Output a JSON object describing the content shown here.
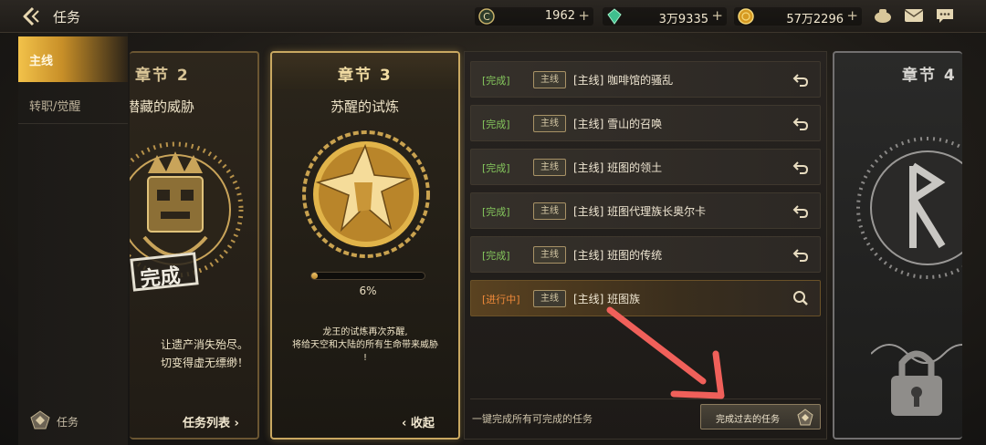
{
  "header": {
    "title": "任务",
    "resources": [
      {
        "icon": "coin-c-icon",
        "value": "1962"
      },
      {
        "icon": "green-gem-icon",
        "value": "3万9335"
      },
      {
        "icon": "gold-coin-icon",
        "value": "57万2296"
      }
    ],
    "plus_symbol": "+"
  },
  "sidebar": {
    "tabs": [
      {
        "label": "主线",
        "selected": true
      },
      {
        "label": "转职/觉醒",
        "selected": false
      }
    ],
    "footer_label": "任务"
  },
  "chapters": [
    {
      "chapter_title": "章节 2",
      "subtitle": "潜藏的威胁",
      "stamp": "完成",
      "description_lines": [
        "让遗产消失殆尽。",
        "切变得虚无缥缈！"
      ],
      "link": "任务列表 ›"
    },
    {
      "chapter_title": "章节 3",
      "subtitle": "苏醒的试炼",
      "progress": 0.06,
      "progress_label": "6%",
      "description_lines": [
        "龙王的试炼再次苏醒,",
        "将给天空和大陆的所有生命带来威胁",
        "!"
      ],
      "link": "‹ 收起"
    },
    {
      "chapter_title": "章节 4"
    }
  ],
  "quests": [
    {
      "status": "[完成]",
      "tag": "主线",
      "name": "[主线] 咖啡馆的骚乱",
      "state": "done"
    },
    {
      "status": "[完成]",
      "tag": "主线",
      "name": "[主线] 雪山的召唤",
      "state": "done"
    },
    {
      "status": "[完成]",
      "tag": "主线",
      "name": "[主线] 班图的领土",
      "state": "done"
    },
    {
      "status": "[完成]",
      "tag": "主线",
      "name": "[主线] 班图代理族长奥尔卡",
      "state": "done"
    },
    {
      "status": "[完成]",
      "tag": "主线",
      "name": "[主线] 班图的传统",
      "state": "done"
    },
    {
      "status": "[进行中]",
      "tag": "主线",
      "name": "[主线] 班图族",
      "state": "in_progress"
    }
  ],
  "footer": {
    "complete_all_label": "一键完成所有可完成的任务",
    "past_quests_button": "完成过去的任务"
  },
  "colors": {
    "accent_gold": "#e7b64a",
    "done_green": "#85c75d",
    "in_progress_orange": "#f08a3a",
    "annotation_arrow": "#f0605a"
  }
}
